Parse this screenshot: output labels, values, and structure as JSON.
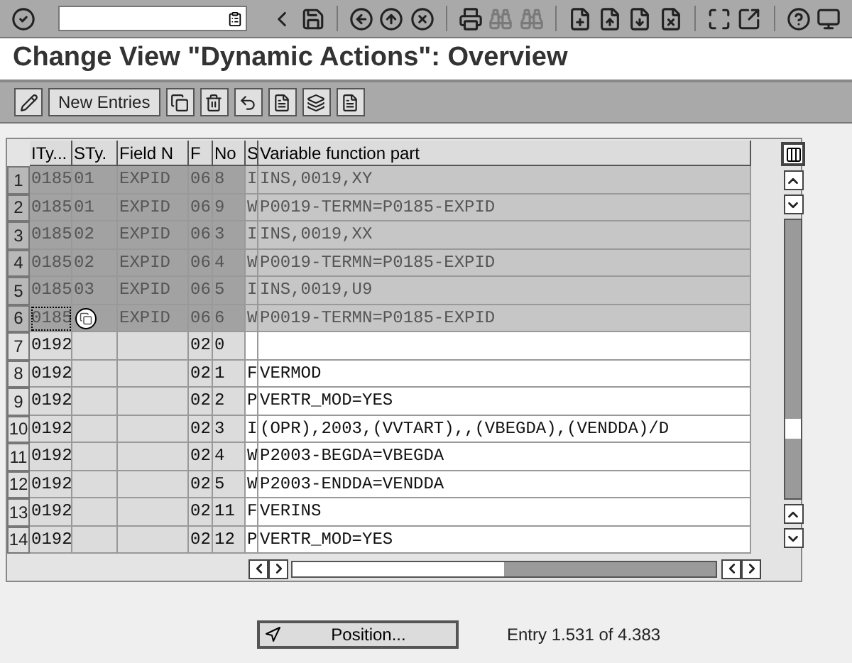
{
  "title": "Change View \"Dynamic Actions\": Overview",
  "app_toolbar": {
    "button": "New Entries"
  },
  "table": {
    "columns": [
      "ITy...",
      "STy.",
      "Field N",
      "F",
      "No",
      "S",
      "Variable function part"
    ],
    "rows": [
      {
        "number": "1",
        "selected": true,
        "focused": false,
        "ity": "0185",
        "sty": "01",
        "field": "EXPID",
        "f": "06",
        "no": "8",
        "s": "I",
        "variable": "INS,0019,XY"
      },
      {
        "number": "2",
        "selected": true,
        "focused": false,
        "ity": "0185",
        "sty": "01",
        "field": "EXPID",
        "f": "06",
        "no": "9",
        "s": "W",
        "variable": "P0019-TERMN=P0185-EXPID"
      },
      {
        "number": "3",
        "selected": true,
        "focused": false,
        "ity": "0185",
        "sty": "02",
        "field": "EXPID",
        "f": "06",
        "no": "3",
        "s": "I",
        "variable": "INS,0019,XX"
      },
      {
        "number": "4",
        "selected": true,
        "focused": false,
        "ity": "0185",
        "sty": "02",
        "field": "EXPID",
        "f": "06",
        "no": "4",
        "s": "W",
        "variable": "P0019-TERMN=P0185-EXPID"
      },
      {
        "number": "5",
        "selected": true,
        "focused": false,
        "ity": "0185",
        "sty": "03",
        "field": "EXPID",
        "f": "06",
        "no": "5",
        "s": "I",
        "variable": "INS,0019,U9"
      },
      {
        "number": "6",
        "selected": true,
        "focused": true,
        "ity": "0185",
        "field": "EXPID",
        "f": "06",
        "no": "6",
        "s": "W",
        "variable": "P0019-TERMN=P0185-EXPID"
      },
      {
        "number": "7",
        "selected": false,
        "focused": false,
        "ity": "0192",
        "f": "02",
        "no": "0"
      },
      {
        "number": "8",
        "selected": false,
        "focused": false,
        "ity": "0192",
        "f": "02",
        "no": "1",
        "s": "F",
        "variable": "VERMOD"
      },
      {
        "number": "9",
        "selected": false,
        "focused": false,
        "ity": "0192",
        "f": "02",
        "no": "2",
        "s": "P",
        "variable": "VERTR_MOD=YES"
      },
      {
        "number": "10",
        "selected": false,
        "focused": false,
        "ity": "0192",
        "f": "02",
        "no": "3",
        "s": "I",
        "variable": "(OPR),2003,(VVTART),,(VBEGDA),(VENDDA)/D"
      },
      {
        "number": "11",
        "selected": false,
        "focused": false,
        "ity": "0192",
        "f": "02",
        "no": "4",
        "s": "W",
        "variable": "P2003-BEGDA=VBEGDA"
      },
      {
        "number": "12",
        "selected": false,
        "focused": false,
        "ity": "0192",
        "f": "02",
        "no": "5",
        "s": "W",
        "variable": "P2003-ENDDA=VENDDA"
      },
      {
        "number": "13",
        "selected": false,
        "focused": false,
        "ity": "0192",
        "f": "02",
        "no": "11",
        "s": "F",
        "variable": "VERINS"
      },
      {
        "number": "14",
        "selected": false,
        "focused": false,
        "ity": "0192",
        "f": "02",
        "no": "12",
        "s": "P",
        "variable": "VERTR_MOD=YES"
      }
    ]
  },
  "position_button": "Position...",
  "entry_info": "Entry 1.531 of 4.383"
}
